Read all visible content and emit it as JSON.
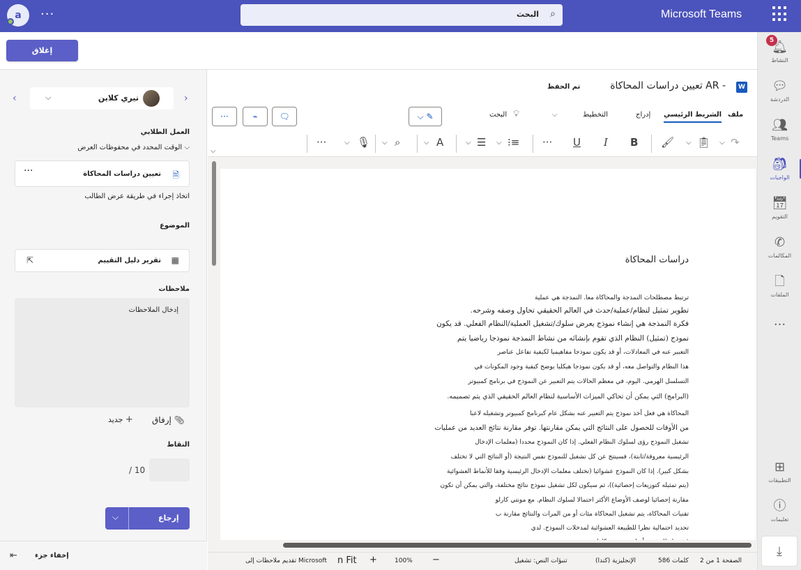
{
  "app": {
    "avatar_initial": "a",
    "more": "···",
    "search_text": "البحث",
    "brand": "Microsoft Teams"
  },
  "rail": {
    "activity": "النشاط",
    "activity_badge": "5",
    "chat": "الدردشة",
    "teams": "Teams",
    "assignments": "الواجبات",
    "calendar": "التقويم",
    "calls": "المكالمات",
    "files": "الملفات",
    "more": "···",
    "apps": "التطبيقات",
    "help": "تعليمات"
  },
  "topbar": {
    "close_label": "إغلاق"
  },
  "left_panel": {
    "student_name": "تيري كلاين",
    "status_heading": "العمل الطلابي",
    "status_value": "الوقت المحدد في محفوظات العرض",
    "assignment_name": "تعيين دراسات المحاكاة",
    "action_note": "اتخاذ إجراء في طريقة عرض الطالب",
    "subject_heading": "الموضوع",
    "rubric_label": "تقرير دليل التقييم",
    "notes_heading": "ملاحظات",
    "notes_placeholder": "إدخال الملاحظات",
    "attach_label": "إرفاق",
    "new_label": "جديد",
    "points_heading": "النقاط",
    "points_max": "/ 10",
    "return_label": "إرجاع",
    "hide_pane_label": "إخفاء جزء"
  },
  "word": {
    "title": "تعيين دراسات المحاكاة AR -",
    "save_status": "تم الحفظ",
    "tabs": {
      "file": "ملف",
      "home": "الشريط الرئيسي",
      "insert": "إدراج",
      "layout": "التخطيط",
      "search": "البحث"
    },
    "toolbar": {
      "bold": "B",
      "italic": "I",
      "underline": "U"
    },
    "document": {
      "heading": "دراسات المحاكاة",
      "lines": [
        "ترتبط مصطلحات النمذجة والمحاكاة معا. النمذجة هي عملية",
        "تطوير تمثيل لنظام/عملية/حدث في العالم الحقيقي تحاول وصفه وشرحه.",
        "فكرة النمذجة هي إنشاء نموذج يعرض سلوك/تشغيل العملية/النظام الفعلي. قد يكون",
        "نموذج (تمثيل) النظام الذي تقوم بإنشائه من نشاط النمذجة نموذجا رياضيا يتم",
        "التعبير عنه في المعادلات، أو قد يكون نموذجا مفاهيميا لكيفية تفاعل عناصر",
        "هذا النظام والتواصل معه، أو قد يكون نموذجا هيكليا يوضح كيفية وجود المكونات في",
        "التسلسل الهرمي. اليوم، في معظم الحالات يتم التعبير عن النموذج في برنامج كمبيوتر",
        "(البرامج) التي يمكن أن تحاكي الميزات الأساسية لنظام العالم الحقيقي الذي يتم تصميمه.",
        "المحاكاة هي فعل أخذ نموذج يتم التعبير عنه بشكل عام كبرنامج كمبيوتر وتشغيله لاعبا",
        "من الأوقات للحصول على النتائج التي يمكن مقارنتها. توفر مقارنة نتائج العديد من عمليات",
        "تشغيل النموذج رؤى لسلوك النظام الفعلي. إذا كان النموذج محددا (معلمات الإدخال",
        "الرئيسية معروفة/ثابتة)، فسينتج عن كل تشغيل للنموذج نفس النتيجة (أو النتائج التي لا تختلف",
        "بشكل كبير). إذا كان النموذج عشوائيا (تختلف معلمات الإدخال الرئيسية وفقا للأنماط العشوائية",
        "(يتم تمثيله كتوزيعات إحصائية))، ثم سيكون لكل تشغيل نموذج نتائج مختلفة، والتي يمكن أن تكون",
        "مقارنة إحصائيا لوصف الأوضاع الأكثر احتمالا لسلوك النظام. مع مونتي كارلو",
        "تقنيات المحاكاة، يتم تشغيل المحاكاة مئات أو من المرات والنتائج مقارنة ب",
        "تحديد احتمالية نظرا للطبيعة العشوائية لمدخلات النموذج. لدي",
        "قدم رابطا يشرح أسلوب مونتي كارلو."
      ]
    },
    "status": {
      "page": "الصفحة 1 من 2",
      "words": "586 كلمات",
      "language": "الإنجليزية (كندا)",
      "predictions": "تنبؤات النص: تشغيل",
      "zoom": "100%",
      "fit": "n Fit",
      "feedback": "تقديم ملاحظات إلى Microsoft"
    }
  }
}
